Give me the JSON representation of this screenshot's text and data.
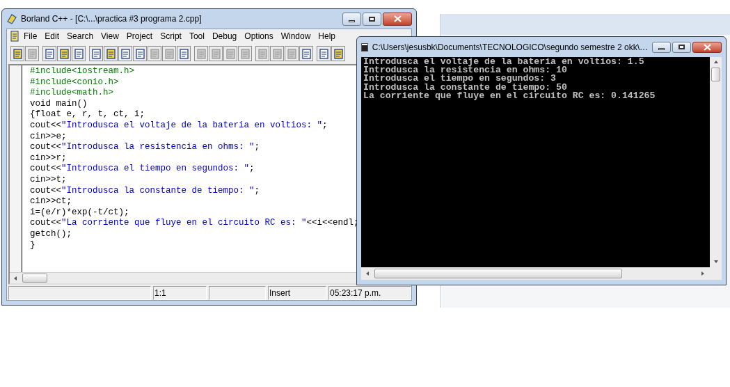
{
  "ide": {
    "title": "Borland C++ - [C:\\...\\practica #3 programa 2.cpp]",
    "menu": [
      {
        "label": "File"
      },
      {
        "label": "Edit"
      },
      {
        "label": "Search"
      },
      {
        "label": "View"
      },
      {
        "label": "Project"
      },
      {
        "label": "Script"
      },
      {
        "label": "Tool"
      },
      {
        "label": "Debug"
      },
      {
        "label": "Options"
      },
      {
        "label": "Window"
      },
      {
        "label": "Help"
      }
    ],
    "toolbar": [
      [
        {
          "disabled": false
        },
        {
          "disabled": true
        }
      ],
      [
        {
          "disabled": false
        },
        {
          "disabled": false
        },
        {
          "disabled": false
        }
      ],
      [
        {
          "disabled": false
        },
        {
          "disabled": false
        },
        {
          "disabled": false
        },
        {
          "disabled": false
        },
        {
          "disabled": true
        },
        {
          "disabled": true
        },
        {
          "disabled": false
        }
      ],
      [
        {
          "disabled": true
        },
        {
          "disabled": true
        },
        {
          "disabled": true
        },
        {
          "disabled": true
        }
      ],
      [
        {
          "disabled": true
        },
        {
          "disabled": true
        },
        {
          "disabled": true
        },
        {
          "disabled": false
        }
      ],
      [
        {
          "disabled": false
        },
        {
          "disabled": false
        }
      ]
    ],
    "code": [
      [
        {
          "kind": "directive",
          "text": "#include<iostream.h>"
        }
      ],
      [
        {
          "kind": "directive",
          "text": "#include<conio.h>"
        }
      ],
      [
        {
          "kind": "directive",
          "text": "#include<math.h>"
        }
      ],
      [
        {
          "kind": "plain",
          "text": "void main()"
        }
      ],
      [
        {
          "kind": "plain",
          "text": "{float e, r, t, ct, i;"
        }
      ],
      [
        {
          "kind": "plain",
          "text": "cout<<"
        },
        {
          "kind": "string",
          "text": "\"Introdusca el voltaje de la bateria en voltios: \""
        },
        {
          "kind": "plain",
          "text": ";"
        }
      ],
      [
        {
          "kind": "plain",
          "text": "cin>>e;"
        }
      ],
      [
        {
          "kind": "plain",
          "text": "cout<<"
        },
        {
          "kind": "string",
          "text": "\"Introdusca la resistencia en ohms: \""
        },
        {
          "kind": "plain",
          "text": ";"
        }
      ],
      [
        {
          "kind": "plain",
          "text": "cin>>r;"
        }
      ],
      [
        {
          "kind": "plain",
          "text": "cout<<"
        },
        {
          "kind": "string",
          "text": "\"Introdusca el tiempo en segundos: \""
        },
        {
          "kind": "plain",
          "text": ";"
        }
      ],
      [
        {
          "kind": "plain",
          "text": "cin>>t;"
        }
      ],
      [
        {
          "kind": "plain",
          "text": "cout<<"
        },
        {
          "kind": "string",
          "text": "\"Introdusca la constante de tiempo: \""
        },
        {
          "kind": "plain",
          "text": ";"
        }
      ],
      [
        {
          "kind": "plain",
          "text": "cin>>ct;"
        }
      ],
      [
        {
          "kind": "plain",
          "text": "i=(e/r)*exp(-t/ct);"
        }
      ],
      [
        {
          "kind": "plain",
          "text": "cout<<"
        },
        {
          "kind": "string",
          "text": "\"La corriente que fluye en el circuito RC es: \""
        },
        {
          "kind": "plain",
          "text": "<<i<<endl;"
        }
      ],
      [
        {
          "kind": "plain",
          "text": "getch();"
        }
      ],
      [
        {
          "kind": "plain",
          "text": "}"
        }
      ]
    ],
    "status_bar": [
      "1:1",
      "Insert",
      "05:23:17 p.m."
    ]
  },
  "console": {
    "title": "C:\\Users\\jesusbk\\Documents\\TECNOLOGICO\\segundo semestre 2 okk\\…",
    "lines": [
      "Introdusca el voltaje de la bateria en voltios: 1.5",
      "Introdusca la resistencia en ohms: 10",
      "Introdusca el tiempo en segundos: 3",
      "Introdusca la constante de tiempo: 50",
      "La corriente que fluye en el circuito RC es: 0.141265"
    ]
  }
}
